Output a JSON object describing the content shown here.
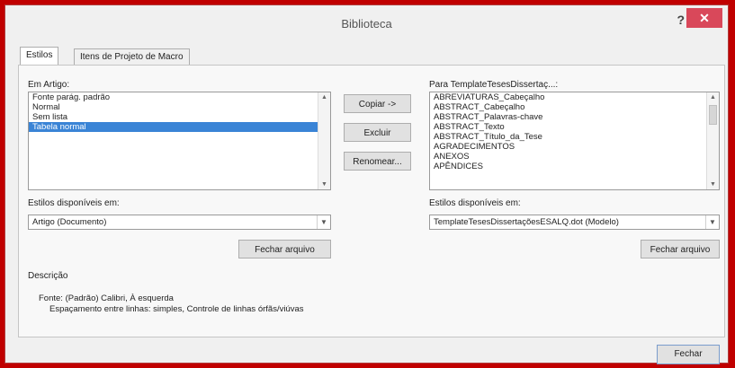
{
  "window": {
    "title": "Biblioteca",
    "help_label": "?",
    "close_label": "✕"
  },
  "tabs": [
    {
      "label": "Estilos",
      "active": true
    },
    {
      "label": "Itens de Projeto de Macro",
      "active": false
    }
  ],
  "left": {
    "label": "Em Artigo:",
    "items": [
      "Fonte parág. padrão",
      "Normal",
      "Sem lista",
      "Tabela normal"
    ],
    "selected_index": 3,
    "available_label": "Estilos disponíveis em:",
    "available_value": "Artigo (Documento)",
    "close_file_button": "Fechar arquivo"
  },
  "middle": {
    "copy_button": "Copiar ->",
    "delete_button": "Excluir",
    "rename_button": "Renomear..."
  },
  "right": {
    "label": "Para TemplateTesesDissertaç...:",
    "items": [
      "ABREVIATURAS_Cabeçalho",
      "ABSTRACT_Cabeçalho",
      "ABSTRACT_Palavras-chave",
      "ABSTRACT_Texto",
      "ABSTRACT_Título_da_Tese",
      "AGRADECIMENTOS",
      "ANEXOS",
      "APÊNDICES"
    ],
    "available_label": "Estilos disponíveis em:",
    "available_value": "TemplateTesesDissertaçõesESALQ.dot (Modelo)",
    "close_file_button": "Fechar arquivo"
  },
  "description": {
    "label": "Descrição",
    "line1": "Fonte: (Padrão) Calibri, À esquerda",
    "line2": "Espaçamento entre linhas:  simples, Controle de linhas órfãs/viúvas"
  },
  "footer": {
    "close_button": "Fechar"
  },
  "colors": {
    "selection": "#3a84d6",
    "frame": "#c00000",
    "close_button": "#d9485a"
  }
}
